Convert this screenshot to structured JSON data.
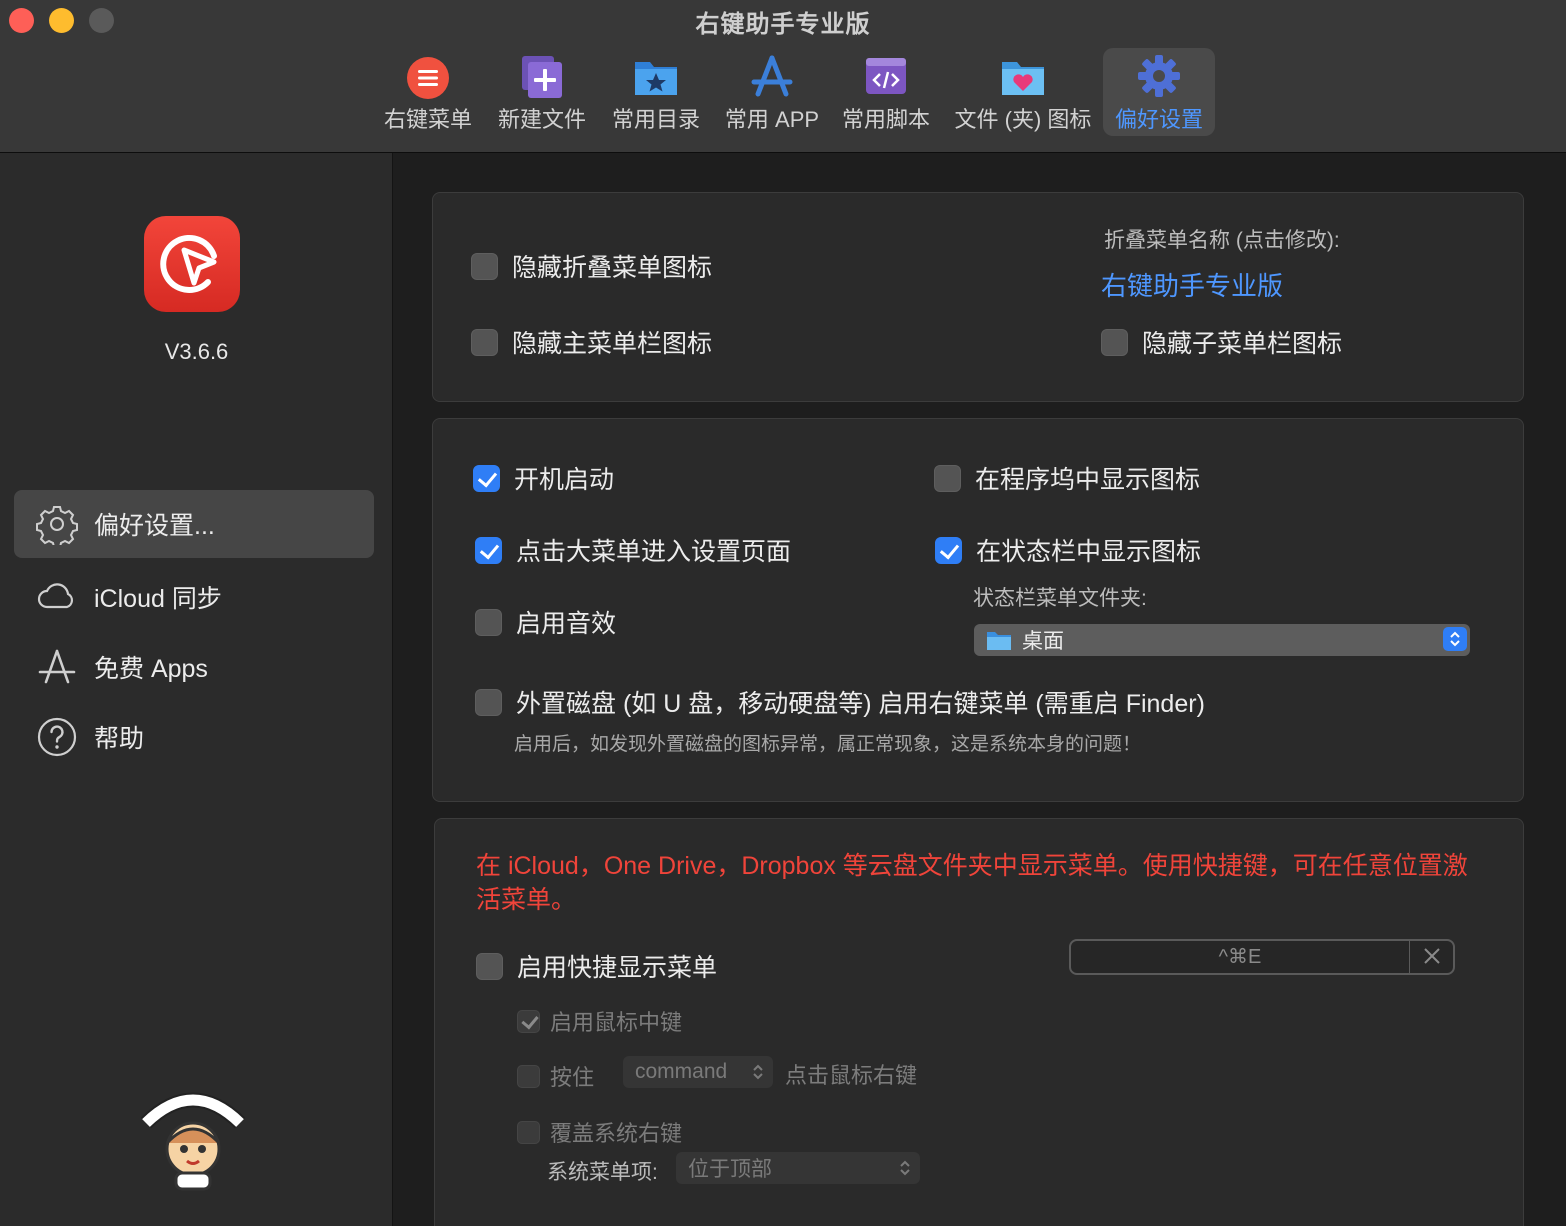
{
  "window": {
    "title": "右键助手专业版"
  },
  "toolbar": {
    "items": [
      {
        "label": "右键菜单",
        "icon": "context-menu-icon",
        "color": "#f0513f"
      },
      {
        "label": "新建文件",
        "icon": "new-file-icon",
        "color": "#7a5cc4"
      },
      {
        "label": "常用目录",
        "icon": "folder-star-icon",
        "color": "#3b8fe0"
      },
      {
        "label": "常用 APP",
        "icon": "app-store-icon",
        "color": "#3b7fd9"
      },
      {
        "label": "常用脚本",
        "icon": "script-icon",
        "color": "#8d5cc8"
      },
      {
        "label": "文件 (夹) 图标",
        "icon": "folder-heart-icon",
        "color": "#48a7e8"
      },
      {
        "label": "偏好设置",
        "icon": "gear-icon",
        "color": "#4e97ff",
        "active": true
      }
    ]
  },
  "sidebar": {
    "version": "V3.6.6",
    "items": [
      {
        "label": "偏好设置...",
        "icon": "gear-icon",
        "selected": true
      },
      {
        "label": "iCloud 同步",
        "icon": "cloud-icon"
      },
      {
        "label": "免费 Apps",
        "icon": "app-store-icon"
      },
      {
        "label": "帮助",
        "icon": "help-icon"
      }
    ],
    "mascot_icon": "tap-here-mascot-icon"
  },
  "panel1": {
    "hide_collapse_icon": {
      "label": "隐藏折叠菜单图标",
      "checked": false
    },
    "hide_main_menubar_icon": {
      "label": "隐藏主菜单栏图标",
      "checked": false
    },
    "menu_name_label": "折叠菜单名称 (点击修改):",
    "menu_name_value": "右键助手专业版",
    "hide_submenu_icon": {
      "label": "隐藏子菜单栏图标",
      "checked": false
    }
  },
  "panel2": {
    "launch_at_login": {
      "label": "开机启动",
      "checked": true
    },
    "show_in_dock": {
      "label": "在程序坞中显示图标",
      "checked": false
    },
    "click_big_menu": {
      "label": "点击大菜单进入设置页面",
      "checked": true
    },
    "show_in_statusbar": {
      "label": "在状态栏中显示图标",
      "checked": true
    },
    "statusbar_folder_label": "状态栏菜单文件夹:",
    "statusbar_folder_value": "桌面",
    "enable_sound": {
      "label": "启用音效",
      "checked": false
    },
    "external_disk": {
      "label": "外置磁盘 (如 U 盘，移动硬盘等) 启用右键菜单 (需重启 Finder)",
      "checked": false
    },
    "external_disk_hint": "启用后，如发现外置磁盘的图标异常，属正常现象，这是系统本身的问题！"
  },
  "panel3": {
    "notice": "在 iCloud，One Drive，Dropbox 等云盘文件夹中显示菜单。使用快捷键，可在任意位置激活菜单。",
    "enable_shortcut": {
      "label": "启用快捷显示菜单",
      "checked": false
    },
    "shortcut_value": "^⌘E",
    "clear_icon": "close-icon",
    "middle_click": {
      "label": "启用鼠标中键",
      "checked": true
    },
    "hold_key": {
      "label": "按住",
      "checked": false
    },
    "hold_key_value": "command",
    "hold_key_suffix": "点击鼠标右键",
    "override_system": {
      "label": "覆盖系统右键",
      "checked": false
    },
    "system_menu_label": "系统菜单项:",
    "system_menu_value": "位于顶部"
  }
}
